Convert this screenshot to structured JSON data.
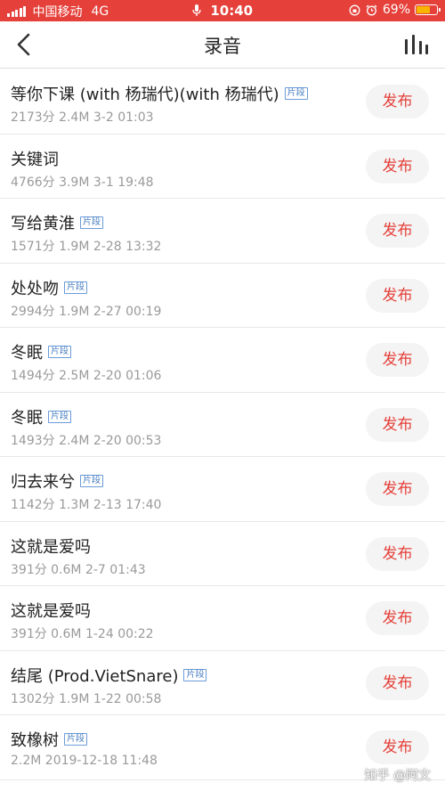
{
  "status_bar": {
    "carrier": "中国移动",
    "network": "4G",
    "time": "10:40",
    "battery_percent": "69%",
    "battery_level": 0.69
  },
  "nav": {
    "title": "录音"
  },
  "list": [
    {
      "title": "等你下课 (with 杨瑞代)(with 杨瑞代)",
      "badge": "片段",
      "meta": "2173分 2.4M 3-2 01:03",
      "action": "发布"
    },
    {
      "title": "关键词",
      "badge": "",
      "meta": "4766分 3.9M 3-1 19:48",
      "action": "发布"
    },
    {
      "title": "写给黄淮",
      "badge": "片段",
      "meta": "1571分 1.9M 2-28 13:32",
      "action": "发布"
    },
    {
      "title": "处处吻",
      "badge": "片段",
      "meta": "2994分 1.9M 2-27 00:19",
      "action": "发布"
    },
    {
      "title": "冬眠",
      "badge": "片段",
      "meta": "1494分 2.5M 2-20 01:06",
      "action": "发布"
    },
    {
      "title": "冬眠",
      "badge": "片段",
      "meta": "1493分 2.4M 2-20 00:53",
      "action": "发布"
    },
    {
      "title": "归去来兮",
      "badge": "片段",
      "meta": "1142分 1.3M 2-13 17:40",
      "action": "发布"
    },
    {
      "title": "这就是爱吗",
      "badge": "",
      "meta": "391分 0.6M 2-7 01:43",
      "action": "发布"
    },
    {
      "title": "这就是爱吗",
      "badge": "",
      "meta": "391分 0.6M 1-24 00:22",
      "action": "发布"
    },
    {
      "title": "结尾 (Prod.VietSnare)",
      "badge": "片段",
      "meta": "1302分 1.9M 1-22 00:58",
      "action": "发布"
    },
    {
      "title": "致橡树",
      "badge": "片段",
      "meta": "2.2M 2019-12-18 11:48",
      "action": "发布"
    }
  ],
  "watermark": "知乎 @阿文"
}
